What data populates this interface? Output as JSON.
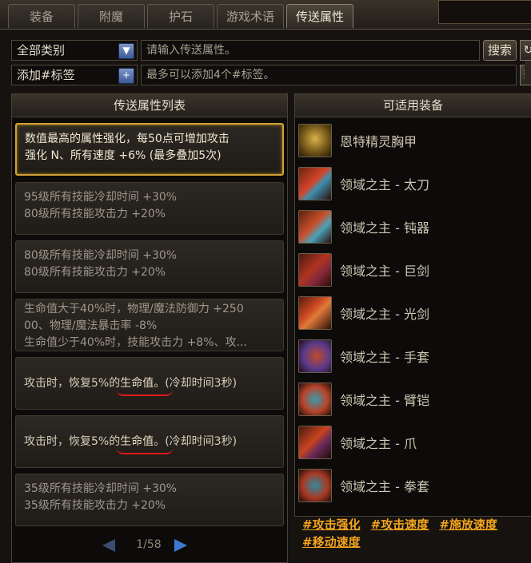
{
  "tabs": [
    {
      "label": "装备",
      "active": false
    },
    {
      "label": "附魔",
      "active": false
    },
    {
      "label": "护石",
      "active": false
    },
    {
      "label": "游戏术语",
      "active": false
    },
    {
      "label": "传送属性",
      "active": true
    }
  ],
  "filter": {
    "category_value": "全部类别",
    "search_placeholder": "请输入传送属性。",
    "search_button": "搜索",
    "tag_select_value": "添加#标签",
    "tag_placeholder": "最多可以添加4个#标签。"
  },
  "left_panel": {
    "title": "传送属性列表",
    "items": [
      {
        "lines": [
          "数值最高的属性强化，每50点可增加攻击",
          "强化 N、所有速度 +6% (最多叠加5次)"
        ],
        "selected": true
      },
      {
        "lines": [
          "95级所有技能冷却时间 +30%",
          "80级所有技能攻击力 +20%"
        ]
      },
      {
        "lines": [
          "80级所有技能冷却时间 +30%",
          "80级所有技能攻击力 +20%"
        ]
      },
      {
        "lines": [
          "生命值大于40%时，物理/魔法防御力 +250",
          "00、物理/魔法暴击率 -8%",
          "生命值少于40%时，技能攻击力 +8%、攻..."
        ]
      },
      {
        "prefix": "攻击时，恢复5%的",
        "highlight": "生命值",
        "suffix": "。(冷却时间3秒)"
      },
      {
        "prefix": "攻击时，恢复5%的",
        "highlight": "生命值",
        "suffix": "。(冷却时间3秒)"
      },
      {
        "lines": [
          "35级所有技能冷却时间 +30%",
          "35级所有技能攻击力 +20%"
        ]
      }
    ],
    "pager": "1/58"
  },
  "right_panel": {
    "title": "可适用装备",
    "items": [
      {
        "name": "恩特精灵胸甲",
        "icon": "armor-icon"
      },
      {
        "name": "领域之主 - 太刀",
        "icon": "katana-icon"
      },
      {
        "name": "领域之主 - 钝器",
        "icon": "blunt-weapon-icon"
      },
      {
        "name": "领域之主 - 巨剑",
        "icon": "greatsword-icon"
      },
      {
        "name": "领域之主 - 光剑",
        "icon": "lightsaber-icon"
      },
      {
        "name": "领域之主 - 手套",
        "icon": "gloves-icon"
      },
      {
        "name": "领域之主 - 臂铠",
        "icon": "gauntlet-icon"
      },
      {
        "name": "领域之主 - 爪",
        "icon": "claw-icon"
      },
      {
        "name": "领域之主 - 拳套",
        "icon": "knuckle-icon"
      }
    ],
    "tags": [
      "#攻击强化",
      "#攻击速度",
      "#施放速度",
      "#移动速度"
    ]
  },
  "colors": {
    "selected_border": "#d4a233",
    "tag_color": "#f2a41d",
    "underline_red": "#e01818",
    "blue_button": "#3d5a99"
  }
}
